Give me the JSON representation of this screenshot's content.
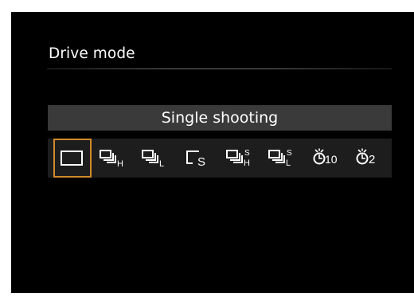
{
  "screen": {
    "title": "Drive mode",
    "selected_mode_label": "Single shooting"
  },
  "drive_modes": [
    {
      "icon": "single-shooting-icon",
      "selected": true
    },
    {
      "icon": "high-speed-continuous-icon",
      "sub": "H",
      "selected": false
    },
    {
      "icon": "low-speed-continuous-icon",
      "sub": "L",
      "selected": false
    },
    {
      "icon": "silent-single-shooting-icon",
      "sub": "S",
      "selected": false
    },
    {
      "icon": "silent-high-speed-continuous-icon",
      "sup": "S",
      "sub": "H",
      "selected": false
    },
    {
      "icon": "silent-low-speed-continuous-icon",
      "sup": "S",
      "sub": "L",
      "selected": false
    },
    {
      "icon": "self-timer-10s-icon",
      "text": "10",
      "selected": false
    },
    {
      "icon": "self-timer-2s-icon",
      "text": "2",
      "selected": false
    }
  ],
  "colors": {
    "background": "#000000",
    "highlight_bar": "#3a3a3a",
    "icon_row": "#1d1d1d",
    "selection_border": "#d08a2a",
    "text": "#ffffff"
  }
}
